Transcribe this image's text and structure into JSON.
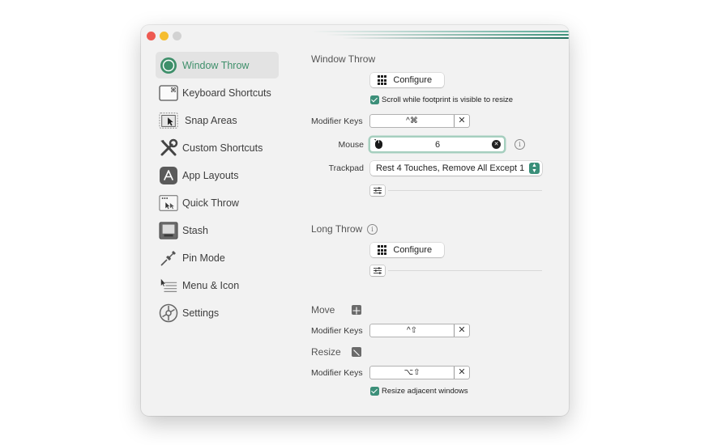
{
  "window": {
    "sidebar": [
      {
        "label": "Window Throw",
        "icon": "window-throw-icon",
        "selected": true
      },
      {
        "label": "Keyboard Shortcuts",
        "icon": "keyboard-shortcuts-icon"
      },
      {
        "label": "Snap Areas",
        "icon": "snap-areas-icon"
      },
      {
        "label": "Custom Shortcuts",
        "icon": "custom-shortcuts-icon"
      },
      {
        "label": "App Layouts",
        "icon": "app-layouts-icon"
      },
      {
        "label": "Quick Throw",
        "icon": "quick-throw-icon"
      },
      {
        "label": "Stash",
        "icon": "stash-icon"
      },
      {
        "label": "Pin Mode",
        "icon": "pin-mode-icon"
      },
      {
        "label": "Menu & Icon",
        "icon": "menu-icon-icon"
      },
      {
        "label": "Settings",
        "icon": "settings-icon"
      }
    ]
  },
  "window_throw": {
    "title": "Window Throw",
    "configure_label": "Configure",
    "scroll_checkbox_label": "Scroll while footprint is visible to resize",
    "scroll_checked": true,
    "modifier_label": "Modifier Keys",
    "modifier_value": "^⌘",
    "mouse_label": "Mouse",
    "mouse_value": "6",
    "trackpad_label": "Trackpad",
    "trackpad_value": "Rest 4 Touches, Remove All Except 1"
  },
  "long_throw": {
    "title": "Long Throw",
    "configure_label": "Configure"
  },
  "move": {
    "title": "Move",
    "modifier_label": "Modifier Keys",
    "modifier_value": "^⇧"
  },
  "resize": {
    "title": "Resize",
    "modifier_label": "Modifier Keys",
    "modifier_value": "⌥⇧",
    "adjacent_label": "Resize adjacent windows",
    "adjacent_checked": true
  },
  "colors": {
    "accent": "#3c8f79",
    "selected_text": "#3e8f6a"
  }
}
